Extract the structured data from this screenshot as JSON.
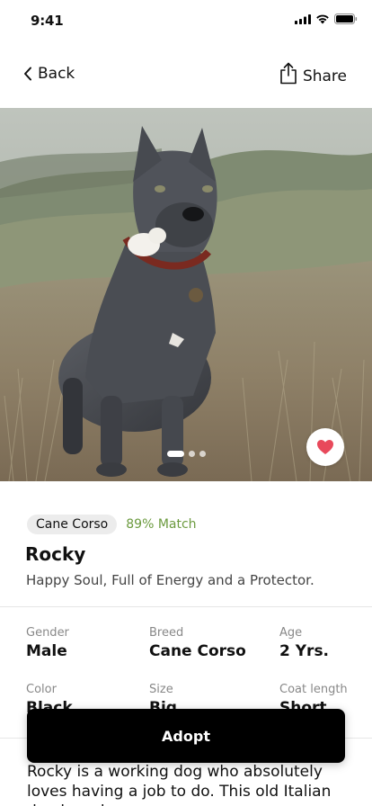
{
  "status_bar": {
    "time": "9:41"
  },
  "nav": {
    "back_label": "Back",
    "share_label": "Share"
  },
  "hero": {
    "image_alt": "Photo of a gray dog standing in dry grass",
    "slide_count": 3,
    "active_slide": 1
  },
  "pet": {
    "breed_tag": "Cane Corso",
    "match": "89% Match",
    "name": "Rocky",
    "tagline": "Happy Soul, Full of Energy and a Protector."
  },
  "attributes": [
    {
      "label": "Gender",
      "value": "Male"
    },
    {
      "label": "Breed",
      "value": "Cane Corso"
    },
    {
      "label": "Age",
      "value": "2 Yrs."
    },
    {
      "label": "Color",
      "value": "Black"
    },
    {
      "label": "Size",
      "value": "Big"
    },
    {
      "label": "Coat length",
      "value": "Short"
    }
  ],
  "description": "Rocky is a working dog who absolutely loves having a job to do. This old Italian dog breed",
  "actions": {
    "adopt_label": "Adopt"
  },
  "colors": {
    "accent": "#000000",
    "match_green": "#6b9a3e",
    "heart": "#e8495b"
  },
  "icons": [
    "signal-icon",
    "wifi-icon",
    "battery-icon",
    "chevron-left-icon",
    "share-icon",
    "heart-icon"
  ]
}
